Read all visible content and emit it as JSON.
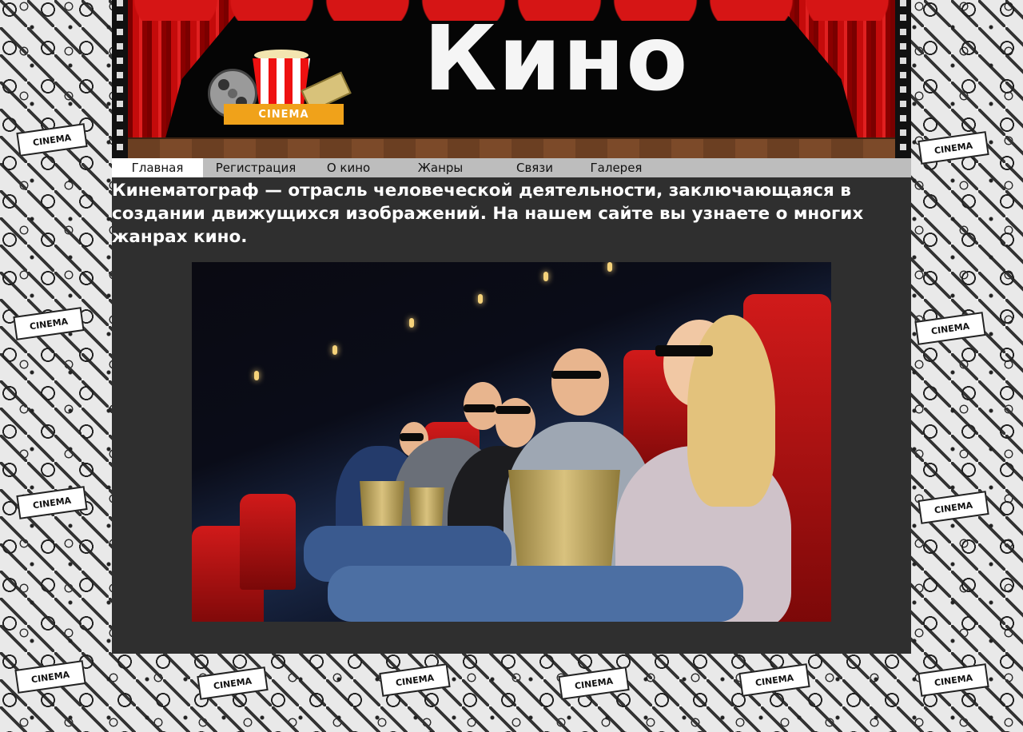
{
  "banner": {
    "title": "Кино",
    "logo_text": "CINEMA"
  },
  "nav": {
    "items": [
      {
        "label": "Главная",
        "active": true
      },
      {
        "label": "Регистрация",
        "active": false
      },
      {
        "label": "О кино",
        "active": false
      },
      {
        "label": "Жанры",
        "active": false
      },
      {
        "label": "Связи",
        "active": false
      },
      {
        "label": "Галерея",
        "active": false
      }
    ]
  },
  "main": {
    "intro": "Кинематограф — отрасль человеческой деятельности, заключающаяся в создании движущихся изображений. На нашем сайте вы узнаете о многих жанрах кино."
  },
  "background": {
    "doodle_label": "CINEMA"
  },
  "colors": {
    "nav_bg": "#bdbdbd",
    "content_bg": "#2f2f2f",
    "active_tab": "#ffffff",
    "text": "#ffffff"
  }
}
